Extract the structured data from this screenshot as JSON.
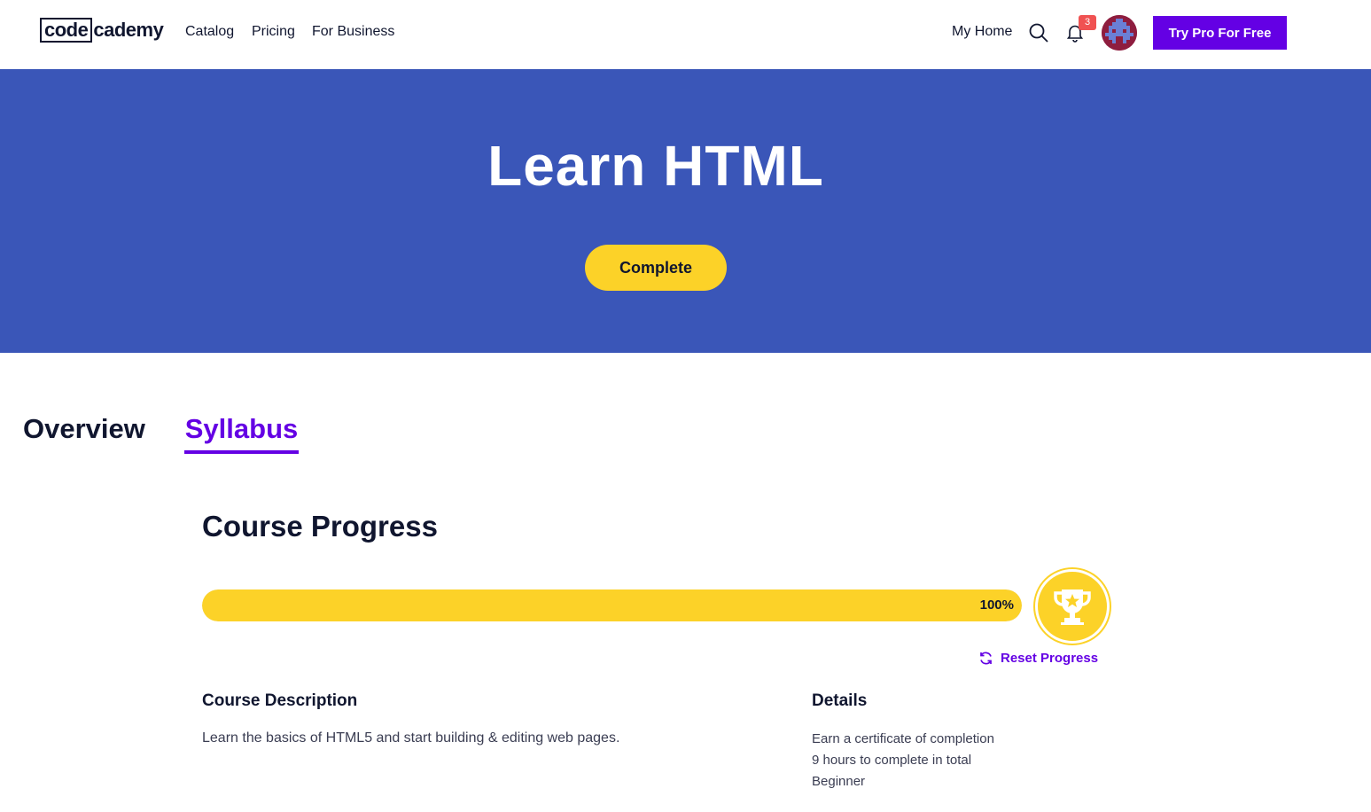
{
  "header": {
    "logo": {
      "boxed": "code",
      "rest": "cademy"
    },
    "nav": [
      "Catalog",
      "Pricing",
      "For Business"
    ],
    "my_home": "My Home",
    "notifications_count": "3",
    "cta": "Try Pro For Free",
    "icons": [
      "search-icon",
      "bell-icon",
      "avatar"
    ]
  },
  "hero": {
    "title": "Learn HTML",
    "status_button": "Complete",
    "background_color": "#3a56b8",
    "button_color": "#fcd228"
  },
  "tabs": [
    {
      "label": "Overview",
      "active": false
    },
    {
      "label": "Syllabus",
      "active": true
    }
  ],
  "progress": {
    "title": "Course Progress",
    "value": 100,
    "label": "100%",
    "reset_label": "Reset Progress",
    "badge_icon": "trophy-icon"
  },
  "description": {
    "title": "Course Description",
    "text": "Learn the basics of HTML5 and start building & editing web pages."
  },
  "details": {
    "title": "Details",
    "items": [
      "Earn a certificate of completion",
      "9 hours to complete in total",
      "Beginner"
    ]
  },
  "colors": {
    "accent": "#6400e4",
    "progress_fill": "#fcd228",
    "text": "#10162f"
  }
}
